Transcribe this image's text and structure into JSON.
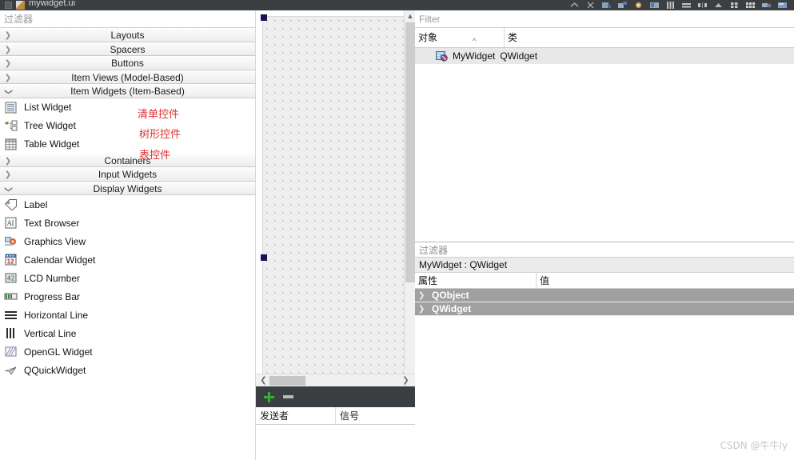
{
  "toolbar": {
    "file_title": "mywidget.ui",
    "icons": [
      "app-icon",
      "ui-file-icon",
      "collapse-caret-icon",
      "close-icon",
      "edit-widgets-icon",
      "edit-signals-icon",
      "edit-buddies-icon",
      "edit-tab-order-icon",
      "layout-horizontal-icon",
      "layout-vertical-icon",
      "layout-splitter-h-icon",
      "layout-splitter-v-icon",
      "layout-grid-icon",
      "layout-form-icon",
      "break-layout-icon",
      "adjust-size-icon"
    ]
  },
  "widget_box": {
    "filter_placeholder": "过滤器",
    "categories": [
      {
        "label": "Layouts",
        "expanded": false
      },
      {
        "label": "Spacers",
        "expanded": false
      },
      {
        "label": "Buttons",
        "expanded": false
      },
      {
        "label": "Item Views (Model-Based)",
        "expanded": false
      },
      {
        "label": "Item Widgets (Item-Based)",
        "expanded": true
      }
    ],
    "item_widgets": [
      {
        "label": "List Widget",
        "icon": "list-widget-icon",
        "annotation": "清单控件"
      },
      {
        "label": "Tree Widget",
        "icon": "tree-widget-icon",
        "annotation": "树形控件"
      },
      {
        "label": "Table Widget",
        "icon": "table-widget-icon",
        "annotation": "表控件"
      }
    ],
    "categories2": [
      {
        "label": "Containers",
        "expanded": false
      },
      {
        "label": "Input Widgets",
        "expanded": false
      },
      {
        "label": "Display Widgets",
        "expanded": true
      }
    ],
    "display_widgets": [
      {
        "label": "Label",
        "icon": "label-icon"
      },
      {
        "label": "Text Browser",
        "icon": "text-browser-icon"
      },
      {
        "label": "Graphics View",
        "icon": "graphics-view-icon"
      },
      {
        "label": "Calendar Widget",
        "icon": "calendar-widget-icon"
      },
      {
        "label": "LCD Number",
        "icon": "lcd-number-icon"
      },
      {
        "label": "Progress Bar",
        "icon": "progress-bar-icon"
      },
      {
        "label": "Horizontal Line",
        "icon": "horizontal-line-icon"
      },
      {
        "label": "Vertical Line",
        "icon": "vertical-line-icon"
      },
      {
        "label": "OpenGL Widget",
        "icon": "opengl-widget-icon"
      },
      {
        "label": "QQuickWidget",
        "icon": "qquickwidget-icon"
      }
    ]
  },
  "canvas": {
    "form_name": "MyWidget",
    "grid": "dotted",
    "handles": 2
  },
  "signal_slot_editor": {
    "add_label": "+",
    "remove_label": "—",
    "columns": [
      "发送者",
      "信号"
    ],
    "rows": []
  },
  "object_inspector": {
    "filter_placeholder": "Filter",
    "columns": [
      "对象",
      "类"
    ],
    "sort_indicator": "^",
    "rows": [
      {
        "object": "MyWidget",
        "class": "QWidget",
        "icon": "widget-icon",
        "selected": true
      }
    ]
  },
  "property_editor": {
    "filter_placeholder": "过滤器",
    "target": "MyWidget : QWidget",
    "columns": [
      "属性",
      "值"
    ],
    "groups": [
      {
        "name": "QObject",
        "expanded": false
      },
      {
        "name": "QWidget",
        "expanded": false
      }
    ]
  },
  "watermark": "CSDN @牛牛ly",
  "colors": {
    "toolbar_bg": "#3c3f41",
    "annotation_red": "#e03030",
    "group_row_bg": "#a0a0a0",
    "selection_bg": "#e8e8e8",
    "handle_navy": "#151552",
    "canvas_bg": "#eeeeee"
  }
}
